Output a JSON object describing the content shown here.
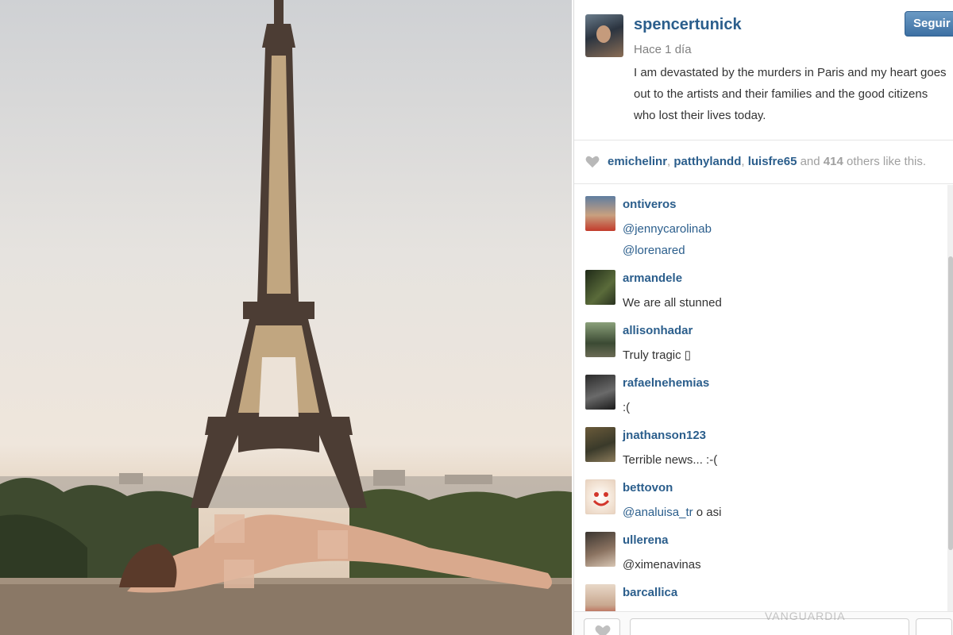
{
  "post": {
    "image_alt": "Eiffel Tower photo",
    "owner": {
      "username": "spencertunick",
      "time": "Hace 1 día",
      "caption": "I am devastated by the murders in Paris and my heart goes out to the artists and their families and the good citizens who lost their lives today."
    },
    "follow_label": "Seguir",
    "likes": {
      "users": [
        "emichelinr",
        "patthylandd",
        "luisfre65"
      ],
      "and_text": "and",
      "count": "414",
      "suffix": "others like this."
    },
    "comments": [
      {
        "user": "ontiveros",
        "lines": [
          "@jennycarolinab",
          "@lorenared"
        ],
        "avatar_icon": "avatar-photo-icon"
      },
      {
        "user": "armandele",
        "lines": [
          "We are all stunned"
        ],
        "avatar_icon": "avatar-photo-icon"
      },
      {
        "user": "allisonhadar",
        "lines": [
          "Truly tragic ▯"
        ],
        "avatar_icon": "avatar-photo-icon"
      },
      {
        "user": "rafaelnehemias",
        "lines": [
          ":("
        ],
        "avatar_icon": "avatar-photo-icon"
      },
      {
        "user": "jnathanson123",
        "lines": [
          "Terrible news... :-("
        ],
        "avatar_icon": "avatar-photo-icon"
      },
      {
        "user": "bettovon",
        "lines": [
          "@analuisa_tr o asi"
        ],
        "avatar_icon": "avatar-photo-icon"
      },
      {
        "user": "ullerena",
        "lines": [
          "@ximenavinas"
        ],
        "avatar_icon": "avatar-photo-icon"
      },
      {
        "user": "barcallica",
        "lines": [],
        "avatar_icon": "avatar-photo-icon"
      }
    ],
    "comment_placeholder": "",
    "watermark": "VANGUARDIA"
  },
  "colors": {
    "username": "#2b5e8c",
    "follow_button": "#3d70a3",
    "muted_text": "#a0a0a0"
  }
}
